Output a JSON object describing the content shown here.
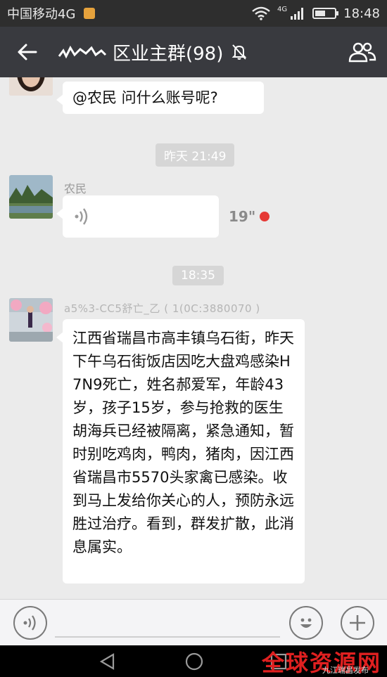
{
  "status_bar": {
    "carrier": "中国移动4G",
    "network_tag": "4G",
    "time": "18:48",
    "battery_level": 0.55
  },
  "header": {
    "title": "区业主群(98)",
    "back_icon": "arrow-left-icon",
    "mute_icon": "bell-off-icon",
    "members_icon": "group-people-icon"
  },
  "chat": {
    "messages": [
      {
        "type": "text",
        "text": "@农民  问什么账号呢?"
      },
      {
        "type": "time",
        "text": "昨天 21:49"
      },
      {
        "type": "voice",
        "sender": "农民",
        "duration": "19\"",
        "unread": true
      },
      {
        "type": "time",
        "text": "18:35"
      },
      {
        "type": "text",
        "sender": "a5%3-CC5舒亡_乙 ( 1(0C:3880070 )",
        "text": "江西省瑞昌市高丰镇乌石街，昨天下午乌石街饭店因吃大盘鸡感染H7N9死亡，姓名郝爱军，年龄43岁，孩子15岁，参与抢救的医生胡海兵已经被隔离，紧急通知，暂时别吃鸡肉，鸭肉，猪肉，因江西省瑞昌市5570头家禽已感染。收到马上发给你关心的人，预防永远胜过治疗。看到，群发扩散，此消息属实。"
      }
    ]
  },
  "input_bar": {
    "voice_icon": "voice-mode-icon",
    "emoji_icon": "smiley-icon",
    "plus_icon": "plus-icon"
  },
  "watermark": {
    "main": "全球资源网",
    "sub": "九江瑞昌发布"
  },
  "colors": {
    "header": "#393a3f",
    "status_bar": "#2e2e2e",
    "chat_bg": "#ebebeb",
    "unread_dot": "#e53935",
    "watermark": "#e02020"
  }
}
